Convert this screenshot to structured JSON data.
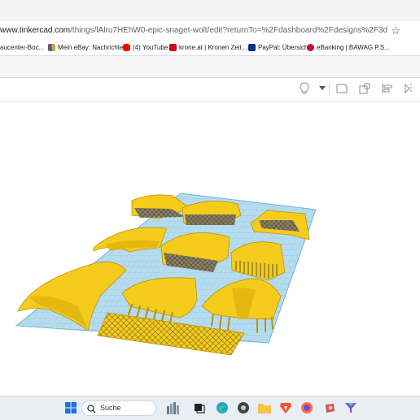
{
  "browser": {
    "url_host": "www.tinkercad.com",
    "url_path": "/things/lAlru7HEhW0-epic-snaget-wolt/edit?returnTo=%2Fdashboard%2Fdesigns%2F3d",
    "bookmark_star_icon": "star-icon"
  },
  "bookmarks": [
    {
      "label": "aucenter-Boc...",
      "icon": "none"
    },
    {
      "label": "Mein eBay: Nachrichten",
      "icon": "ebay-bag-icon"
    },
    {
      "label": "(4) YouTube",
      "icon": "youtube-icon"
    },
    {
      "label": "krone.at | Kronen Zeit...",
      "icon": "krone-icon"
    },
    {
      "label": "PayPal: Übersicht",
      "icon": "paypal-icon"
    },
    {
      "label": "eBanking | BAWAG P.S...",
      "icon": "bawag-icon"
    }
  ],
  "toolbar": {
    "icons": [
      "lightbulb-icon",
      "dropdown-chevron-icon",
      "note-icon",
      "ruler-icon",
      "align-icon",
      "mirror-icon"
    ]
  },
  "taskbar": {
    "search_label": "Suche",
    "icons": [
      "windows-start-icon",
      "search-icon",
      "widgets-icon",
      "taskview-icon",
      "edge-icon",
      "app-icon",
      "file-explorer-icon",
      "brave-icon",
      "firefox-icon",
      "game-icon",
      "filter-app-icon"
    ]
  },
  "colors": {
    "part_yellow": "#f5cc1c",
    "grid_blue": "#b7dcef",
    "grid_line": "#8fc6e2"
  }
}
